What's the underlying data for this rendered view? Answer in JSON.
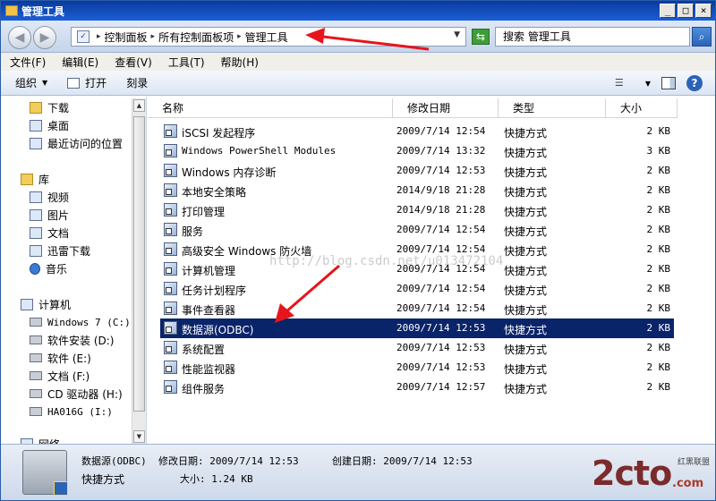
{
  "window": {
    "title": "管理工具"
  },
  "window_buttons": [
    "_",
    "□",
    "×"
  ],
  "nav": {
    "breadcrumb": [
      "控制面板",
      "所有控制面板项",
      "管理工具"
    ],
    "search_placeholder": "搜索 管理工具"
  },
  "menu": [
    "文件(F)",
    "编辑(E)",
    "查看(V)",
    "工具(T)",
    "帮助(H)"
  ],
  "toolbar": {
    "organize": "组织",
    "open": "打开",
    "burn": "刻录"
  },
  "sidebar": {
    "items": [
      {
        "label": "下载",
        "icon": "folder"
      },
      {
        "label": "桌面",
        "icon": "desktop"
      },
      {
        "label": "最近访问的位置",
        "icon": "recent"
      },
      {
        "label": "库",
        "icon": "folder"
      },
      {
        "label": "视频",
        "icon": "video"
      },
      {
        "label": "图片",
        "icon": "picture"
      },
      {
        "label": "文档",
        "icon": "document"
      },
      {
        "label": "迅雷下载",
        "icon": "document"
      },
      {
        "label": "音乐",
        "icon": "music"
      },
      {
        "label": "计算机",
        "icon": "computer"
      },
      {
        "label": "Windows 7 (C:)",
        "icon": "drive"
      },
      {
        "label": "软件安装 (D:)",
        "icon": "drive"
      },
      {
        "label": "软件 (E:)",
        "icon": "drive"
      },
      {
        "label": "文档 (F:)",
        "icon": "drive"
      },
      {
        "label": "CD 驱动器 (H:)",
        "icon": "cd-drive"
      },
      {
        "label": "HA016G (I:)",
        "icon": "usb-drive"
      },
      {
        "label": "网络",
        "icon": "network"
      }
    ]
  },
  "columns": {
    "name": "名称",
    "date": "修改日期",
    "type": "类型",
    "size": "大小"
  },
  "files": [
    {
      "name": "iSCSI 发起程序",
      "date": "2009/7/14 12:54",
      "type": "快捷方式",
      "size": "2 KB"
    },
    {
      "name": "Windows PowerShell Modules",
      "date": "2009/7/14 13:32",
      "type": "快捷方式",
      "size": "3 KB"
    },
    {
      "name": "Windows 内存诊断",
      "date": "2009/7/14 12:53",
      "type": "快捷方式",
      "size": "2 KB"
    },
    {
      "name": "本地安全策略",
      "date": "2014/9/18 21:28",
      "type": "快捷方式",
      "size": "2 KB"
    },
    {
      "name": "打印管理",
      "date": "2014/9/18 21:28",
      "type": "快捷方式",
      "size": "2 KB"
    },
    {
      "name": "服务",
      "date": "2009/7/14 12:54",
      "type": "快捷方式",
      "size": "2 KB"
    },
    {
      "name": "高级安全 Windows 防火墙",
      "date": "2009/7/14 12:54",
      "type": "快捷方式",
      "size": "2 KB"
    },
    {
      "name": "计算机管理",
      "date": "2009/7/14 12:54",
      "type": "快捷方式",
      "size": "2 KB"
    },
    {
      "name": "任务计划程序",
      "date": "2009/7/14 12:54",
      "type": "快捷方式",
      "size": "2 KB"
    },
    {
      "name": "事件查看器",
      "date": "2009/7/14 12:54",
      "type": "快捷方式",
      "size": "2 KB"
    },
    {
      "name": "数据源(ODBC)",
      "date": "2009/7/14 12:53",
      "type": "快捷方式",
      "size": "2 KB",
      "selected": true
    },
    {
      "name": "系统配置",
      "date": "2009/7/14 12:53",
      "type": "快捷方式",
      "size": "2 KB"
    },
    {
      "name": "性能监视器",
      "date": "2009/7/14 12:53",
      "type": "快捷方式",
      "size": "2 KB"
    },
    {
      "name": "组件服务",
      "date": "2009/7/14 12:57",
      "type": "快捷方式",
      "size": "2 KB"
    }
  ],
  "watermark": "http://blog.csdn.net/u013472104",
  "details": {
    "name": "数据源(ODBC)",
    "modified": "修改日期: 2009/7/14 12:53",
    "created": "创建日期: 2009/7/14 12:53",
    "type": "快捷方式",
    "size": "大小: 1.24 KB"
  },
  "logo": {
    "main": "2cto",
    "small": "红黑联盟",
    "domain": ".com"
  },
  "colors": {
    "selection": "#0a246a",
    "titlebar": "#0a3a9c",
    "arrow": "#e8141c"
  }
}
